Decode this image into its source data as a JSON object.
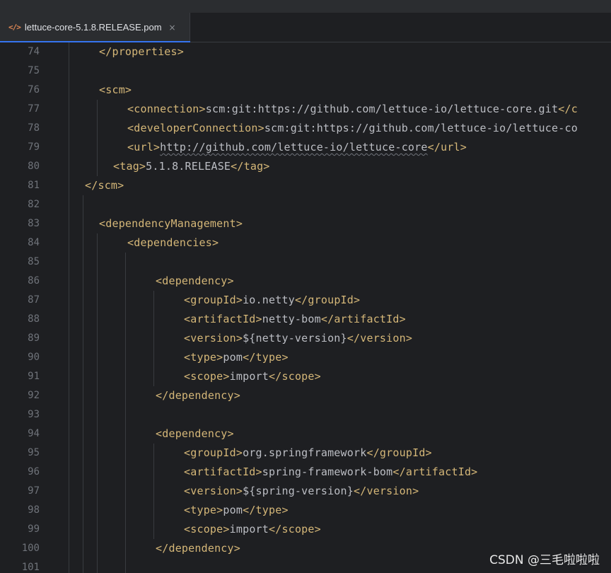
{
  "tab": {
    "icon": "</>",
    "label": "lettuce-core-5.1.8.RELEASE.pom",
    "close": "×"
  },
  "lines": [
    {
      "num": "74",
      "parts": [
        [
          "tag",
          "</properties>"
        ]
      ]
    },
    {
      "num": "75",
      "parts": []
    },
    {
      "num": "76",
      "parts": [
        [
          "tag",
          "<scm>"
        ]
      ]
    },
    {
      "num": "77",
      "parts": [
        [
          "tag",
          "<connection>"
        ],
        [
          "txt",
          "scm:git:https://github.com/lettuce-io/lettuce-core.git"
        ],
        [
          "tag",
          "</c"
        ]
      ]
    },
    {
      "num": "78",
      "parts": [
        [
          "tag",
          "<developerConnection>"
        ],
        [
          "txt",
          "scm:git:https://github.com/lettuce-io/lettuce-co"
        ]
      ]
    },
    {
      "num": "79",
      "parts": [
        [
          "tag",
          "<url>"
        ],
        [
          "txt",
          "http://github.com/lettuce-io/lettuce-core"
        ],
        [
          "tag",
          "</url>"
        ]
      ]
    },
    {
      "num": "80",
      "parts": [
        [
          "tag",
          "<tag>"
        ],
        [
          "txt",
          "5.1.8.RELEASE"
        ],
        [
          "tag",
          "</tag>"
        ]
      ]
    },
    {
      "num": "81",
      "parts": [
        [
          "tag",
          "</scm>"
        ]
      ]
    },
    {
      "num": "82",
      "parts": []
    },
    {
      "num": "83",
      "parts": [
        [
          "tag",
          "<dependencyManagement>"
        ]
      ]
    },
    {
      "num": "84",
      "parts": [
        [
          "tag",
          "<dependencies>"
        ]
      ]
    },
    {
      "num": "85",
      "parts": []
    },
    {
      "num": "86",
      "parts": [
        [
          "tag",
          "<dependency>"
        ]
      ]
    },
    {
      "num": "87",
      "parts": [
        [
          "tag",
          "<groupId>"
        ],
        [
          "txt",
          "io.netty"
        ],
        [
          "tag",
          "</groupId>"
        ]
      ]
    },
    {
      "num": "88",
      "parts": [
        [
          "tag",
          "<artifactId>"
        ],
        [
          "txt",
          "netty-bom"
        ],
        [
          "tag",
          "</artifactId>"
        ]
      ]
    },
    {
      "num": "89",
      "parts": [
        [
          "tag",
          "<version>"
        ],
        [
          "txt",
          "${netty-version}"
        ],
        [
          "tag",
          "</version>"
        ]
      ]
    },
    {
      "num": "90",
      "parts": [
        [
          "tag",
          "<type>"
        ],
        [
          "txt",
          "pom"
        ],
        [
          "tag",
          "</type>"
        ]
      ]
    },
    {
      "num": "91",
      "parts": [
        [
          "tag",
          "<scope>"
        ],
        [
          "txt",
          "import"
        ],
        [
          "tag",
          "</scope>"
        ]
      ]
    },
    {
      "num": "92",
      "parts": [
        [
          "tag",
          "</dependency>"
        ]
      ]
    },
    {
      "num": "93",
      "parts": []
    },
    {
      "num": "94",
      "parts": [
        [
          "tag",
          "<dependency>"
        ]
      ]
    },
    {
      "num": "95",
      "parts": [
        [
          "tag",
          "<groupId>"
        ],
        [
          "txt",
          "org.springframework"
        ],
        [
          "tag",
          "</groupId>"
        ]
      ]
    },
    {
      "num": "96",
      "parts": [
        [
          "tag",
          "<artifactId>"
        ],
        [
          "txt",
          "spring-framework-bom"
        ],
        [
          "tag",
          "</artifactId>"
        ]
      ]
    },
    {
      "num": "97",
      "parts": [
        [
          "tag",
          "<version>"
        ],
        [
          "txt",
          "${spring-version}"
        ],
        [
          "tag",
          "</version>"
        ]
      ]
    },
    {
      "num": "98",
      "parts": [
        [
          "tag",
          "<type>"
        ],
        [
          "txt",
          "pom"
        ],
        [
          "tag",
          "</type>"
        ]
      ]
    },
    {
      "num": "99",
      "parts": [
        [
          "tag",
          "<scope>"
        ],
        [
          "txt",
          "import"
        ],
        [
          "tag",
          "</scope>"
        ]
      ]
    },
    {
      "num": "100",
      "parts": [
        [
          "tag",
          "</dependency>"
        ]
      ]
    },
    {
      "num": "101",
      "parts": []
    }
  ],
  "watermark": "CSDN @三毛啦啦啦",
  "colors": {
    "background": "#1e1f22",
    "tag": "#d5b778",
    "text": "#bcbec4",
    "line_number": "#6f737a",
    "tab_accent": "#3574f0"
  }
}
